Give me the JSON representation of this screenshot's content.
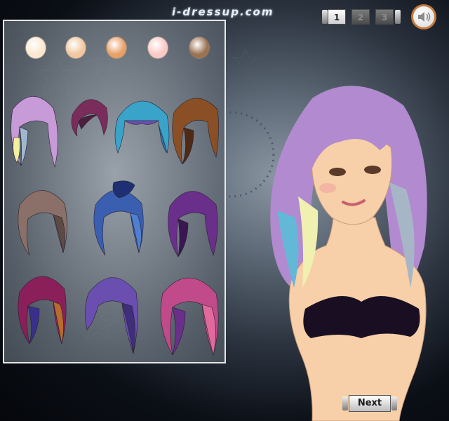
{
  "site": {
    "logo_text": "i-dressup.com"
  },
  "page_nav": {
    "pages": [
      "1",
      "2",
      "3"
    ],
    "active": "1"
  },
  "sound": {
    "icon": "speaker-icon"
  },
  "skin_tones": [
    "#fbe7d0",
    "#f0c7a0",
    "#e7a068",
    "#f9c9c4",
    "#9c7352"
  ],
  "hairstyles": [
    {
      "name": "long-pastel-rainbow",
      "colors": [
        "#c79ad8",
        "#9fb8d0",
        "#f3f0a0"
      ]
    },
    {
      "name": "short-bob-maroon",
      "colors": [
        "#7a2c5a",
        "#4b1f3f",
        "#a5477a"
      ]
    },
    {
      "name": "bangs-teal-purple",
      "colors": [
        "#3aa3c9",
        "#6a4fb0",
        "#2f6fa3"
      ]
    },
    {
      "name": "side-swept-brown",
      "colors": [
        "#8a4f24",
        "#4f2a14",
        "#b86a2f"
      ]
    },
    {
      "name": "wavy-ash-brown",
      "colors": [
        "#8a7068",
        "#5c4a46",
        "#a58c80"
      ]
    },
    {
      "name": "ponytail-blue",
      "colors": [
        "#3a5fb0",
        "#1f2f73",
        "#4f7fd0"
      ]
    },
    {
      "name": "long-violet",
      "colors": [
        "#6a2f8a",
        "#3a1750",
        "#a04f86"
      ]
    },
    {
      "name": "choppy-multicolor",
      "colors": [
        "#8a1f5a",
        "#3a2f8a",
        "#b86a2f"
      ]
    },
    {
      "name": "straight-purple",
      "colors": [
        "#6a4fb0",
        "#3f2f7a",
        "#8a6fd0"
      ]
    },
    {
      "name": "curly-pink-purple",
      "colors": [
        "#c04a8a",
        "#6a2f8a",
        "#e06a9a"
      ]
    }
  ],
  "model": {
    "hair_colors": [
      "#b28ad0",
      "#a7b6c6",
      "#f0f0b0",
      "#63b8d8"
    ],
    "top_color": "#1a0f22",
    "skin": "#f7cfa8"
  },
  "next_button": {
    "label": "Next"
  }
}
